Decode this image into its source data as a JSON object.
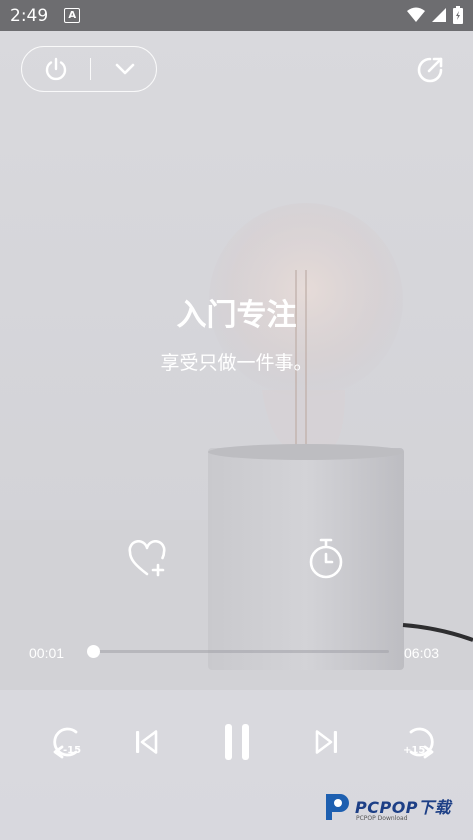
{
  "status_bar": {
    "time": "2:49",
    "notification_badge": "A"
  },
  "session": {
    "title": "入门专注",
    "subtitle": "享受只做一件事。"
  },
  "player": {
    "current_time": "00:01",
    "total_time": "06:03",
    "progress": 0.003
  },
  "controls": {
    "rewind_label": "-15",
    "forward_label": "+15",
    "state": "playing"
  },
  "watermark": {
    "brand": "PCPOP下载",
    "sub": "PCPOP Download"
  },
  "colors": {
    "status_bar": "#6d6d70",
    "background": "#d6d6da",
    "text": "#ffffff",
    "watermark": "#1d3f86"
  },
  "icons": [
    "power-icon",
    "chevron-down-icon",
    "share-icon",
    "heart-add-icon",
    "timer-icon",
    "rewind-15-icon",
    "previous-icon",
    "pause-icon",
    "next-icon",
    "forward-15-icon"
  ]
}
